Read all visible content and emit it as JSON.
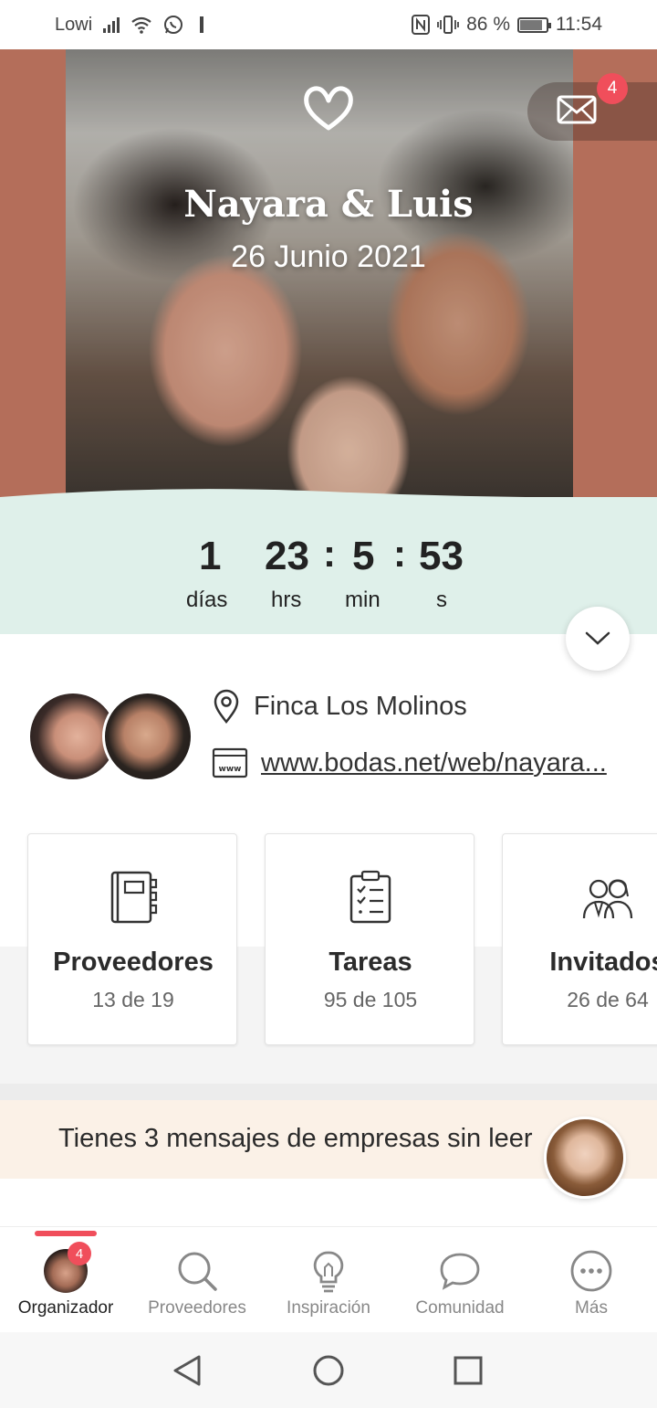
{
  "status_bar": {
    "carrier": "Lowi",
    "battery": "86 %",
    "time": "11:54"
  },
  "header": {
    "couple_name": "Nayara & Luis",
    "wedding_date": "26 Junio 2021",
    "mail_badge": "4"
  },
  "countdown": {
    "days": "1",
    "days_label": "días",
    "hours": "23",
    "hours_label": "hrs",
    "minutes": "5",
    "minutes_label": "min",
    "seconds": "53",
    "seconds_label": "s",
    "separator": ":"
  },
  "info": {
    "venue": "Finca Los Molinos",
    "website": "www.bodas.net/web/nayara..."
  },
  "cards": [
    {
      "title": "Proveedores",
      "count": "13 de 19"
    },
    {
      "title": "Tareas",
      "count": "95 de 105"
    },
    {
      "title": "Invitados",
      "count": "26 de 64"
    }
  ],
  "banner": {
    "text": "Tienes 3 mensajes de empresas sin leer"
  },
  "bottom_nav": {
    "items": [
      {
        "label": "Organizador",
        "badge": "4"
      },
      {
        "label": "Proveedores"
      },
      {
        "label": "Inspiración"
      },
      {
        "label": "Comunidad"
      },
      {
        "label": "Más"
      }
    ]
  },
  "colors": {
    "accent": "#f04e5b",
    "countdown_bg": "#dff0ea",
    "banner_bg": "#fbf1e7",
    "hero_side": "#b46e5a"
  }
}
